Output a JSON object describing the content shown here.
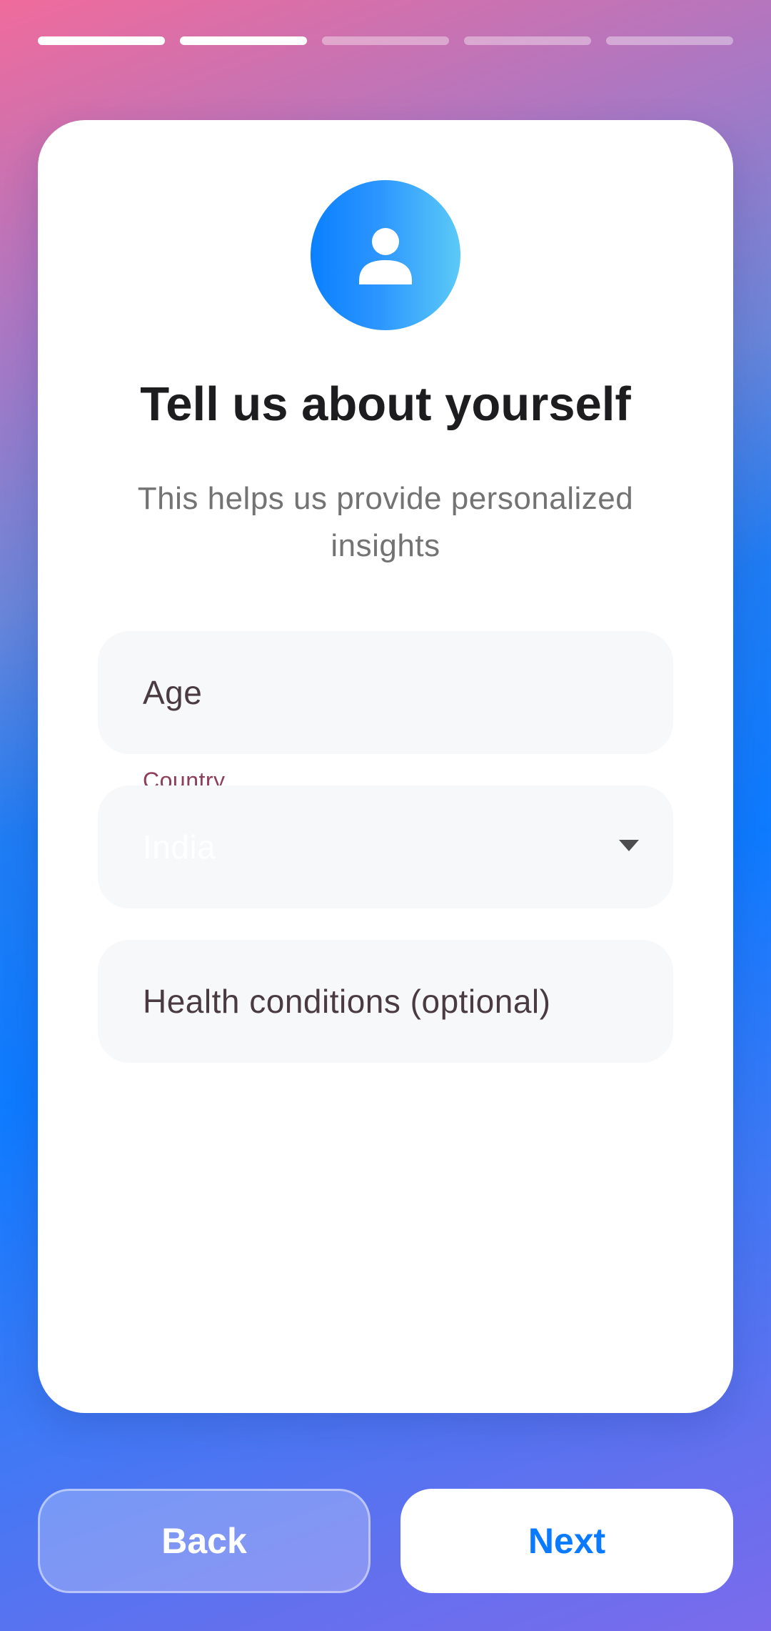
{
  "progress": {
    "total_steps": 5,
    "completed_steps": 2
  },
  "header": {
    "avatar_icon": "person-icon",
    "title": "Tell us about yourself",
    "subtitle": "This helps us provide personalized insights"
  },
  "form": {
    "age": {
      "placeholder": "Age"
    },
    "country": {
      "label": "Country",
      "value": "India"
    },
    "health": {
      "placeholder": "Health conditions (optional)"
    }
  },
  "buttons": {
    "back_label": "Back",
    "next_label": "Next"
  },
  "colors": {
    "accent": "#0a7aff",
    "label_accent": "#8e3d5a"
  }
}
